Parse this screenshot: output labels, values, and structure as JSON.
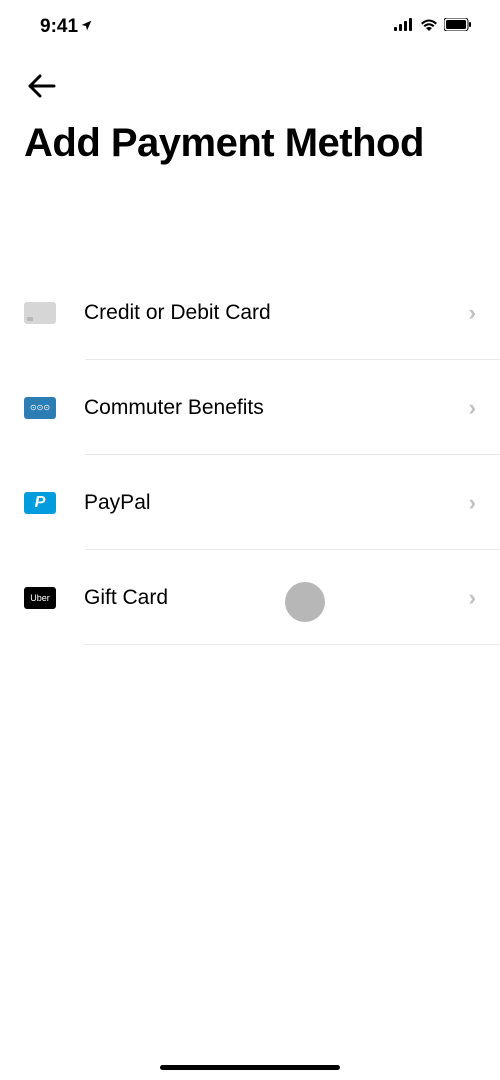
{
  "statusBar": {
    "time": "9:41"
  },
  "page": {
    "title": "Add Payment Method"
  },
  "options": [
    {
      "label": "Credit or Debit Card",
      "iconName": "card-icon"
    },
    {
      "label": "Commuter Benefits",
      "iconName": "commuter-icon"
    },
    {
      "label": "PayPal",
      "iconName": "paypal-icon"
    },
    {
      "label": "Gift Card",
      "iconName": "uber-icon"
    }
  ],
  "iconText": {
    "commuter": "⊙⊙⊙",
    "paypal": "P",
    "uber": "Uber"
  }
}
